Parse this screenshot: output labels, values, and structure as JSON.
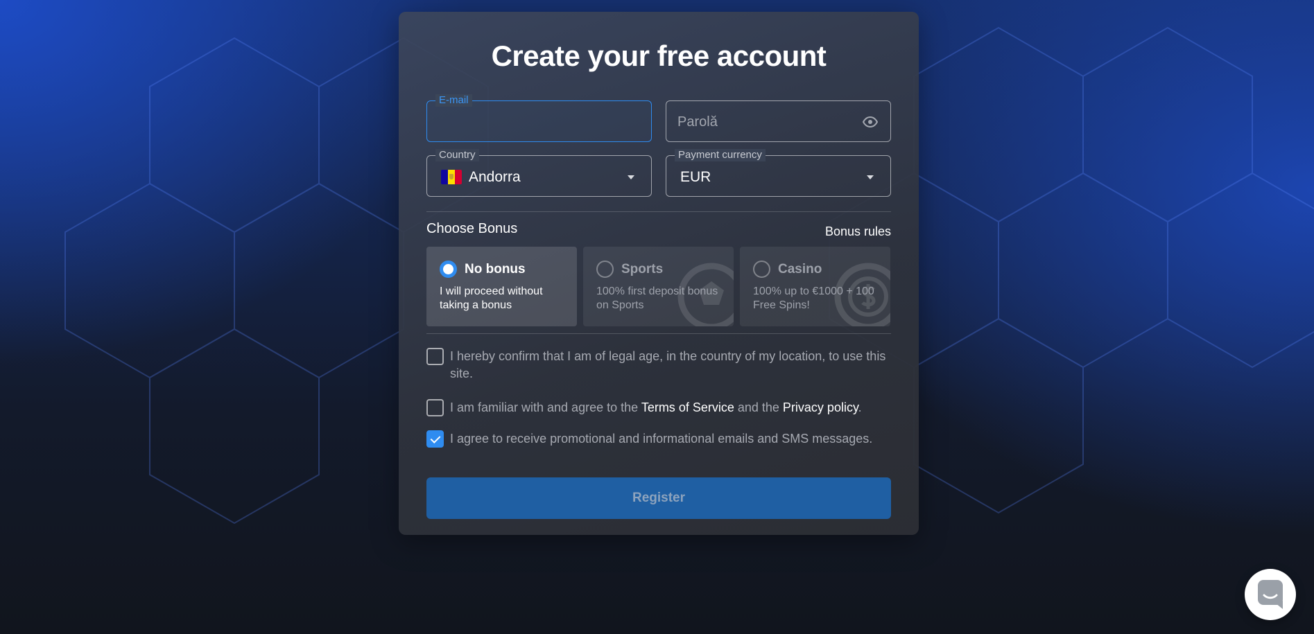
{
  "form": {
    "title": "Create your free account",
    "email": {
      "label": "E-mail",
      "value": ""
    },
    "password": {
      "placeholder": "Parolă"
    },
    "country": {
      "label": "Country",
      "value": "Andorra"
    },
    "currency": {
      "label": "Payment currency",
      "value": "EUR"
    },
    "bonus": {
      "heading": "Choose Bonus",
      "rules_link": "Bonus rules",
      "selected": "No bonus",
      "options": [
        {
          "name": "No bonus",
          "description": "I will proceed without taking a bonus"
        },
        {
          "name": "Sports",
          "description": "100% first deposit bonus on Sports"
        },
        {
          "name": "Casino",
          "description": "100% up to €1000 + 100 Free Spins!"
        }
      ]
    },
    "consents": [
      {
        "text": "I hereby confirm that I am of legal age, in the country of my location, to use this site.",
        "checked": false
      },
      {
        "text_before": "I am familiar with and agree to the ",
        "link1": "Terms of Service",
        "text_middle": " and the ",
        "link2": "Privacy policy",
        "text_after": ".",
        "checked": false
      },
      {
        "text": "I agree to receive promotional and informational emails and SMS messages.",
        "checked": true
      }
    ],
    "register_label": "Register"
  },
  "colors": {
    "accent": "#2f8cf0",
    "button": "#1f5fa3"
  },
  "icons": {
    "password_toggle": "eye-icon",
    "chat": "chat-icon"
  }
}
